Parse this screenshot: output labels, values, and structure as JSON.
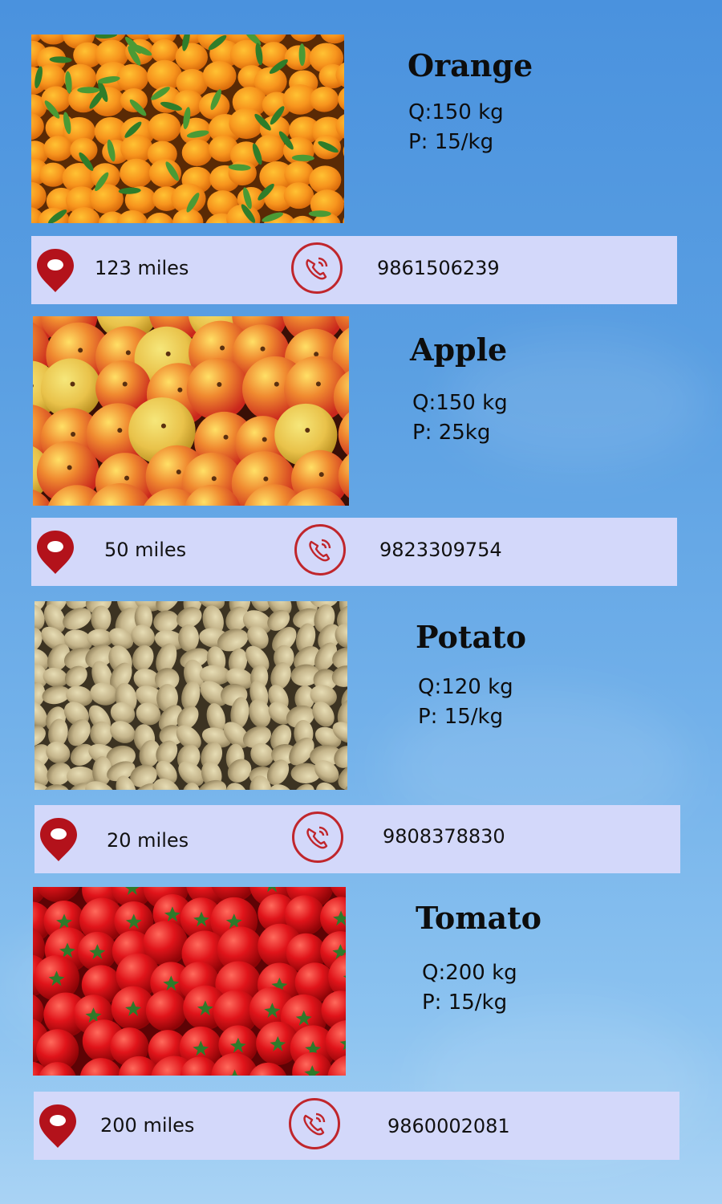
{
  "products": [
    {
      "name": "Orange",
      "quantity": "Q:150 kg",
      "price": "P: 15/kg",
      "distance": "123 miles",
      "phone": "9861506239",
      "image": "orange-pile-photo"
    },
    {
      "name": "Apple",
      "quantity": "Q:150 kg",
      "price": "P: 25kg",
      "distance": "50 miles",
      "phone": "9823309754",
      "image": "apple-pile-photo"
    },
    {
      "name": "Potato",
      "quantity": "Q:120 kg",
      "price": "P: 15/kg",
      "distance": "20 miles",
      "phone": "9808378830",
      "image": "potato-pile-photo"
    },
    {
      "name": "Tomato",
      "quantity": "Q:200 kg",
      "price": "P: 15/kg",
      "distance": "200 miles",
      "phone": "9860002081",
      "image": "tomato-pile-photo"
    }
  ],
  "icons": {
    "location": "location-pin-icon",
    "call": "phone-call-icon"
  },
  "colors": {
    "background": "#5a9fe2",
    "bar": "#d3d8fa",
    "accent": "#c0262c",
    "pin": "#b3121b"
  }
}
